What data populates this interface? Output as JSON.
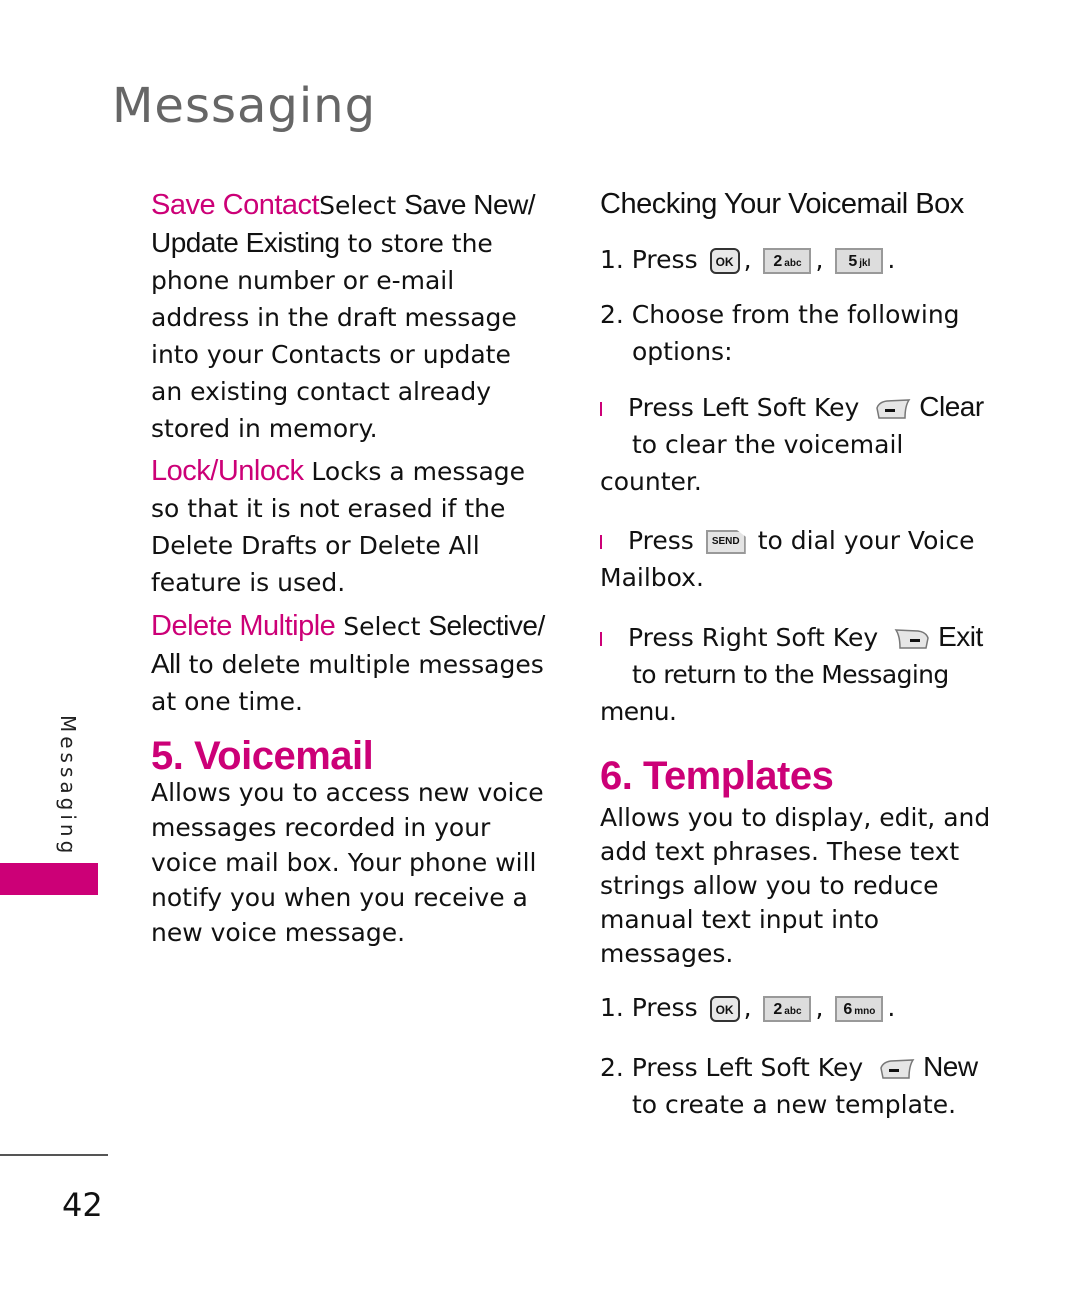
{
  "header": {
    "title": "Messaging"
  },
  "sidebar": {
    "label": "Messaging",
    "accent_color": "#cc0077"
  },
  "footer": {
    "page_number": "42"
  },
  "left_column": {
    "save_contact": {
      "term": "Save Contact",
      "text1": "Select ",
      "option": "Save New/ Update Existing",
      "text2": " to store the phone number or e-mail address in the draft message into your Contacts or update an existing contact already stored in memory."
    },
    "lock_unlock": {
      "term": "Lock/Unlock",
      "text": " Locks a message so that it is not erased if the Delete Drafts or Delete All feature is used."
    },
    "delete_multiple": {
      "term": "Delete Multiple",
      "text1": " Select ",
      "option": "Selective/ All",
      "text2": " to delete multiple messages at one time."
    },
    "voicemail": {
      "heading": "5. Voicemail",
      "body": "Allows you to access new voice messages recorded in your voice mail box. Your phone will notify you when you receive a new voice message."
    }
  },
  "right_column": {
    "checking": {
      "subheading": "Checking Your Voicemail Box",
      "step1_prefix": "1. Press",
      "step1_keys": [
        {
          "icon": "ok-key-icon",
          "label": "OK"
        },
        {
          "icon": "key-2-icon",
          "num": "2",
          "letters": "abc"
        },
        {
          "icon": "key-5-icon",
          "num": "5",
          "letters": "jkl"
        }
      ],
      "step2": "2. Choose from the following options:",
      "options": [
        {
          "prefix": "Press Left Soft Key",
          "key_icon": "left-soft-key-icon",
          "action": "Clear",
          "suffix": "to clear the voicemail counter."
        },
        {
          "prefix": "Press",
          "key_icon": "send-key-icon",
          "key_label": "SEND",
          "suffix": "to dial your Voice Mailbox."
        },
        {
          "prefix": "Press Right Soft Key",
          "key_icon": "right-soft-key-icon",
          "action": "Exit",
          "suffix": "to return to the Messaging menu."
        }
      ]
    },
    "templates": {
      "heading": "6. Templates",
      "body": "Allows you to display, edit, and add text phrases. These text strings allow you to reduce manual text input into messages.",
      "step1_prefix": "1. Press",
      "step1_keys": [
        {
          "icon": "ok-key-icon",
          "label": "OK"
        },
        {
          "icon": "key-2-icon",
          "num": "2",
          "letters": "abc"
        },
        {
          "icon": "key-6-icon",
          "num": "6",
          "letters": "mno"
        }
      ],
      "step2_prefix": "2. Press Left Soft Key",
      "step2_action": "New",
      "step2_suffix": "to create a new template."
    }
  }
}
